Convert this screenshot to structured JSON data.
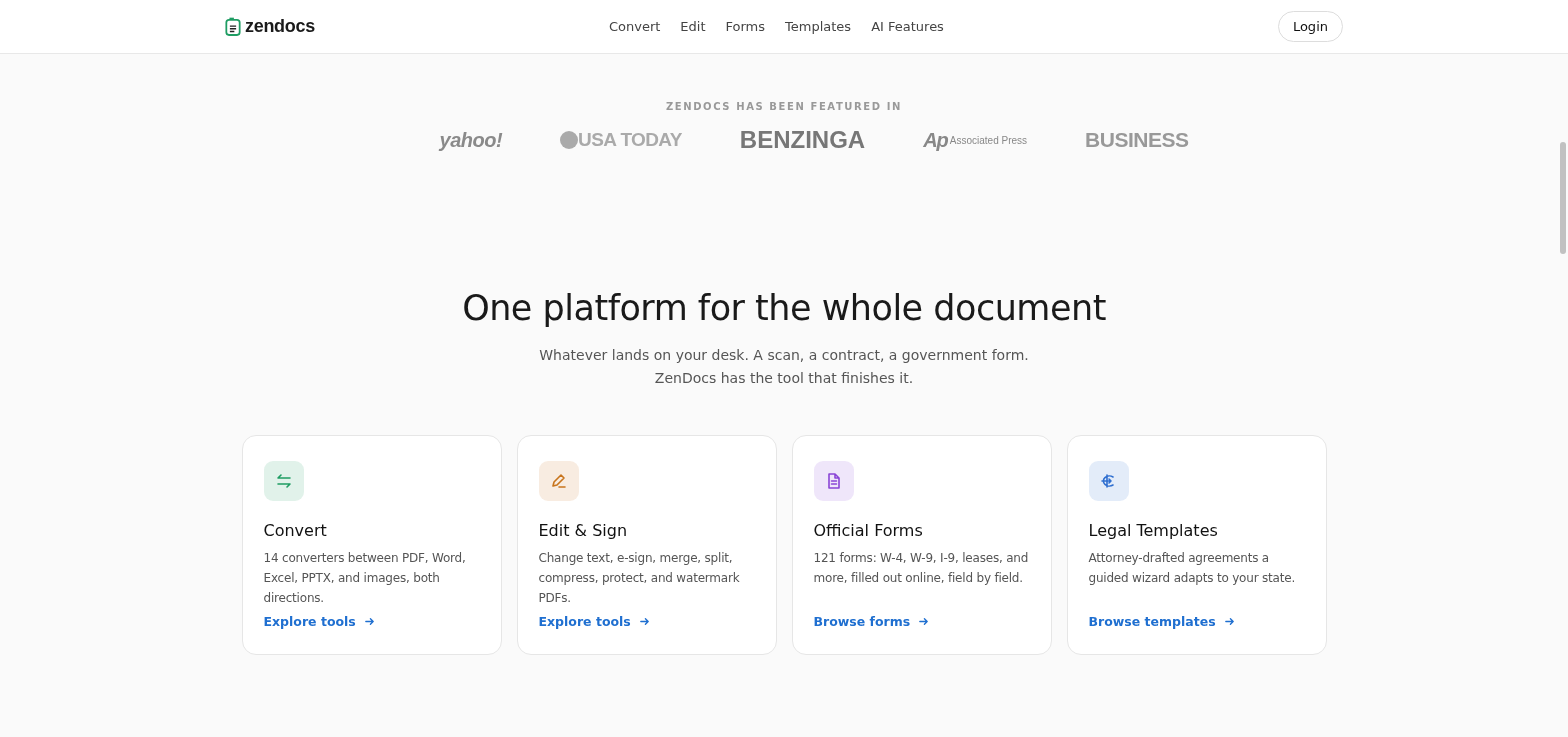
{
  "header": {
    "brand": "zendocs",
    "nav": [
      {
        "label": "Convert"
      },
      {
        "label": "Edit"
      },
      {
        "label": "Forms"
      },
      {
        "label": "Templates"
      },
      {
        "label": "AI Features"
      }
    ],
    "login": "Login"
  },
  "featured": {
    "heading": "ZENDOCS HAS BEEN FEATURED IN",
    "logos": [
      {
        "kind": "italic",
        "text": "yahoo!"
      },
      {
        "kind": "dot",
        "text": "USA TODAY"
      },
      {
        "kind": "plain",
        "text": "BENZINGA"
      },
      {
        "kind": "ap",
        "mark": "Ap",
        "text": "Associated Press"
      },
      {
        "kind": "cut",
        "text": "BUSINESS"
      }
    ]
  },
  "section": {
    "title": "One platform for the whole document",
    "subtitle_lines": [
      "Whatever lands on your desk. A scan, a contract, a government form.",
      "ZenDocs has the tool that finishes it."
    ]
  },
  "cards": [
    {
      "color": "#1f9d63",
      "title": "Convert",
      "text": "14 converters between PDF, Word, Excel, PPTX, and images, both directions.",
      "link": "Explore tools"
    },
    {
      "color": "#c8741c",
      "title": "Edit & Sign",
      "text": "Change text, e-sign, merge, split, compress, protect, and watermark PDFs.",
      "link": "Explore tools"
    },
    {
      "color": "#8a45d6",
      "title": "Official Forms",
      "text": "121 forms: W-4, W-9, I-9, leases, and more, filled out online, field by field.",
      "link": "Browse forms"
    },
    {
      "color": "#2f6fd0",
      "title": "Legal Templates",
      "text": "Attorney-drafted agreements a guided wizard adapts to your state.",
      "link": "Browse templates"
    }
  ]
}
